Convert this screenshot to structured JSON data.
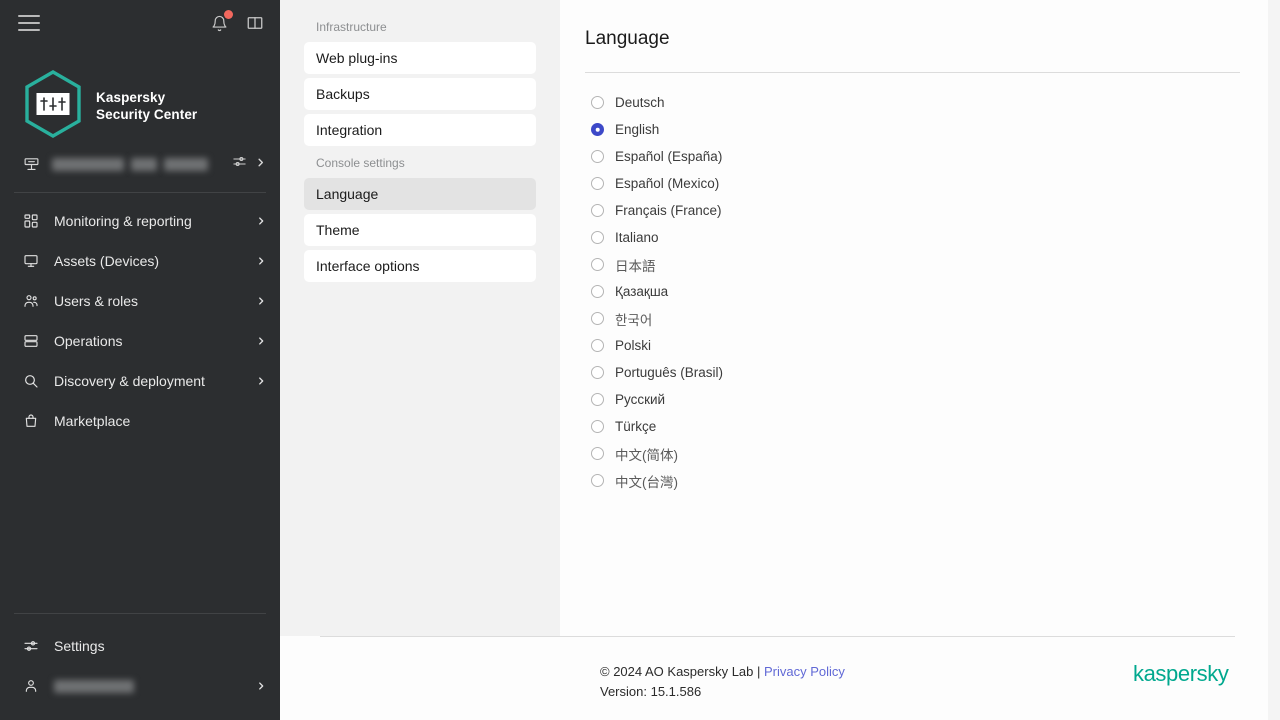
{
  "colors": {
    "sidebar_bg": "#2c2e30",
    "midpanel_bg": "#f2f2f2",
    "content_bg": "#fdfdfd",
    "brand_teal": "#00a88e",
    "accent_blue": "#3d49c8",
    "badge_red": "#f2685e",
    "link_blue": "#6169d6"
  },
  "sidebar": {
    "topbar": {
      "menu_icon": "hamburger-menu-icon",
      "notifications_icon": "bell-icon",
      "notifications_has_badge": true,
      "help_icon": "book-icon"
    },
    "logo": {
      "mark_icon": "kaspersky-hexagon-logo",
      "line1": "Kaspersky",
      "line2": "Security Center"
    },
    "server": {
      "icon": "server-icon",
      "name_redacted": true,
      "settings_icon": "sliders-icon",
      "chevron_icon": "chevron-right-icon"
    },
    "nav_items": [
      {
        "label": "Monitoring & reporting",
        "icon": "dashboard-icon",
        "has_chevron": true
      },
      {
        "label": "Assets (Devices)",
        "icon": "monitor-icon",
        "has_chevron": true
      },
      {
        "label": "Users & roles",
        "icon": "users-icon",
        "has_chevron": true
      },
      {
        "label": "Operations",
        "icon": "servers-stack-icon",
        "has_chevron": true
      },
      {
        "label": "Discovery & deployment",
        "icon": "magnifier-icon",
        "has_chevron": true
      },
      {
        "label": "Marketplace",
        "icon": "bag-icon",
        "has_chevron": false
      }
    ],
    "bottom": {
      "settings_label": "Settings",
      "settings_icon": "sliders-icon",
      "account_icon": "user-icon",
      "account_redacted": true,
      "account_chevron_icon": "chevron-right-icon"
    }
  },
  "midpanel": {
    "groups": [
      {
        "label": "Infrastructure",
        "items": [
          {
            "label": "Web plug-ins",
            "selected": false
          },
          {
            "label": "Backups",
            "selected": false
          },
          {
            "label": "Integration",
            "selected": false
          }
        ]
      },
      {
        "label": "Console settings",
        "items": [
          {
            "label": "Language",
            "selected": true
          },
          {
            "label": "Theme",
            "selected": false
          },
          {
            "label": "Interface options",
            "selected": false
          }
        ]
      }
    ]
  },
  "content": {
    "title": "Language",
    "languages": [
      {
        "label": "Deutsch",
        "selected": false,
        "cjk": false
      },
      {
        "label": "English",
        "selected": true,
        "cjk": false
      },
      {
        "label": "Español (España)",
        "selected": false,
        "cjk": false
      },
      {
        "label": "Español (Mexico)",
        "selected": false,
        "cjk": false
      },
      {
        "label": "Français (France)",
        "selected": false,
        "cjk": false
      },
      {
        "label": "Italiano",
        "selected": false,
        "cjk": false
      },
      {
        "label": "日本語",
        "selected": false,
        "cjk": true
      },
      {
        "label": "Қазақша",
        "selected": false,
        "cjk": false
      },
      {
        "label": "한국어",
        "selected": false,
        "cjk": true
      },
      {
        "label": "Polski",
        "selected": false,
        "cjk": false
      },
      {
        "label": "Português (Brasil)",
        "selected": false,
        "cjk": false
      },
      {
        "label": "Русский",
        "selected": false,
        "cjk": false
      },
      {
        "label": "Türkçe",
        "selected": false,
        "cjk": false
      },
      {
        "label": "中文(简体)",
        "selected": false,
        "cjk": true
      },
      {
        "label": "中文(台灣)",
        "selected": false,
        "cjk": true
      }
    ]
  },
  "footer": {
    "copyright": "© 2024 AO Kaspersky Lab | ",
    "privacy_link": "Privacy Policy",
    "version": "Version: 15.1.586",
    "brand_wordmark": "kaspersky"
  }
}
